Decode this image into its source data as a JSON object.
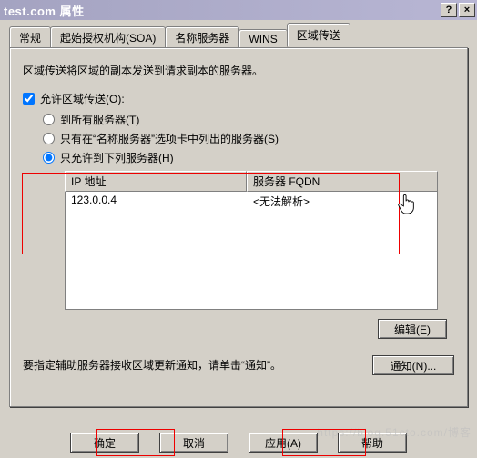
{
  "window": {
    "title": "test.com 属性",
    "help_glyph": "?",
    "close_glyph": "×"
  },
  "tabs": [
    {
      "label": "常规"
    },
    {
      "label": "起始授权机构(SOA)"
    },
    {
      "label": "名称服务器"
    },
    {
      "label": "WINS"
    },
    {
      "label": "区域传送"
    }
  ],
  "active_tab": 4,
  "transfer": {
    "description": "区域传送将区域的副本发送到请求副本的服务器。",
    "allow_checkbox_label": "允许区域传送(O):",
    "allow_checked": true,
    "radios": {
      "to_all": "到所有服务器(T)",
      "only_ns_tab": "只有在“名称服务器”选项卡中列出的服务器(S)",
      "only_following": "只允许到下列服务器(H)"
    },
    "selected_radio": "only_following",
    "columns": {
      "ip": "IP 地址",
      "fqdn": "服务器 FQDN"
    },
    "rows": [
      {
        "ip": "123.0.0.4",
        "fqdn": "<无法解析>"
      }
    ],
    "edit_button": "编辑(E)",
    "notify_text": "要指定辅助服务器接收区域更新通知，请单击“通知”。",
    "notify_button": "通知(N)..."
  },
  "buttons": {
    "ok": "确定",
    "cancel": "取消",
    "apply": "应用(A)",
    "help": "帮助"
  },
  "watermark": "https://blog.51cto.com/博客"
}
